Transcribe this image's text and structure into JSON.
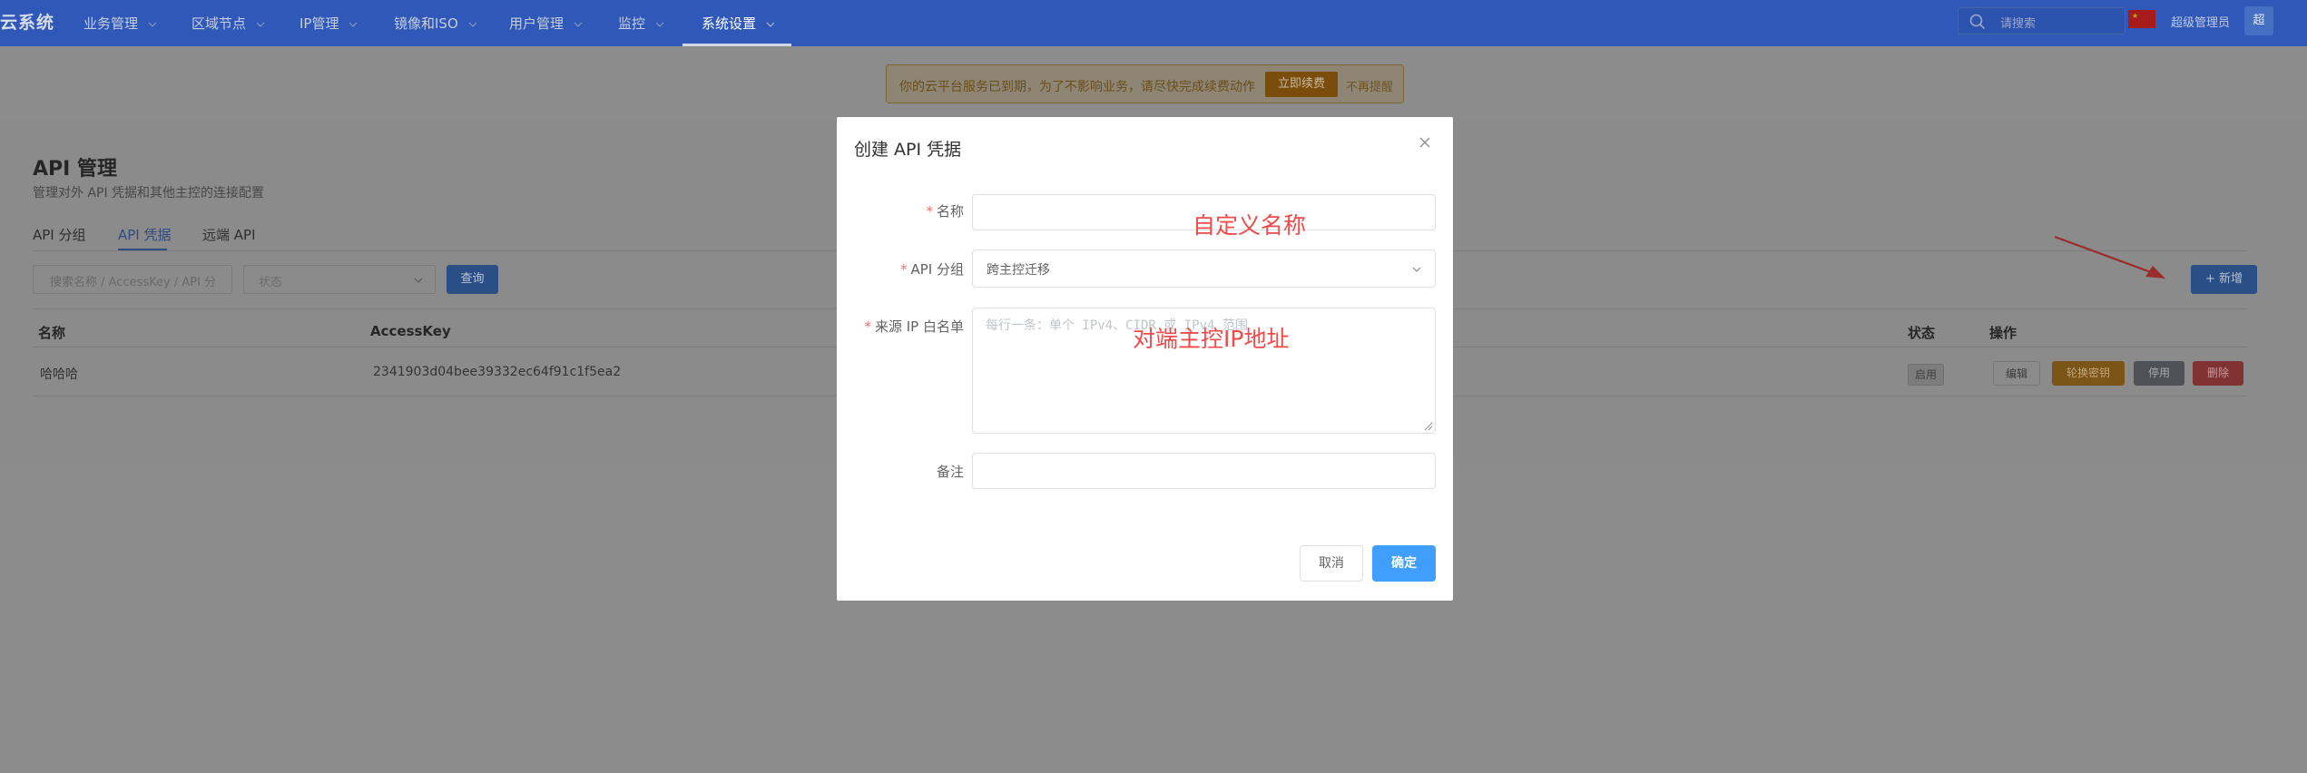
{
  "brand": "云系统",
  "nav": {
    "items": [
      {
        "label": "业务管理"
      },
      {
        "label": "区域节点"
      },
      {
        "label": "IP管理"
      },
      {
        "label": "镜像和ISO"
      },
      {
        "label": "用户管理"
      },
      {
        "label": "监控"
      },
      {
        "label": "系统设置"
      }
    ],
    "search_placeholder": "请搜索",
    "user_name": "超级管理员",
    "user_avatar": "超"
  },
  "notice": {
    "text": "你的云平台服务已到期，为了不影响业务，请尽快完成续费动作",
    "renew_label": "立即续费",
    "dismiss_label": "不再提醒"
  },
  "page": {
    "title": "API 管理",
    "subtitle": "管理对外 API 凭据和其他主控的连接配置",
    "tabs": [
      {
        "label": "API 分组"
      },
      {
        "label": "API 凭据"
      },
      {
        "label": "远端 API"
      }
    ],
    "active_tab": "API 凭据",
    "filter_placeholder": "搜索名称 / AccessKey / API 分",
    "status_placeholder": "状态",
    "query_label": "查询",
    "add_label": "+ 新增",
    "table": {
      "headers": [
        "名称",
        "AccessKey",
        "状态",
        "操作"
      ],
      "rows": [
        {
          "name": "哈哈哈",
          "access_key": "2341903d04bee39332ec64f91c1f5ea2",
          "status": "启用",
          "actions": [
            "编辑",
            "轮换密钥",
            "停用",
            "删除"
          ]
        }
      ]
    }
  },
  "modal": {
    "title": "创建 API 凭据",
    "fields": {
      "name": {
        "label": "名称",
        "value": ""
      },
      "group": {
        "label": "API 分组",
        "value": "跨主控迁移"
      },
      "whitelist": {
        "label": "来源 IP 白名单",
        "placeholder": "每行一条：单个 IPv4、CIDR 或 IPv4 范围"
      },
      "remark": {
        "label": "备注",
        "value": ""
      }
    },
    "annotations": {
      "name_hint": "自定义名称",
      "whitelist_hint": "对端主控IP地址"
    },
    "cancel_label": "取消",
    "confirm_label": "确定"
  },
  "colors": {
    "topbar": "#2f58b8",
    "primary": "#409eff",
    "annotation": "#f04a4a",
    "required": "#f56c6c",
    "overlay": "#8b8b8b"
  },
  "icons": [
    "search-icon",
    "flag-icon",
    "chevron-down-icon",
    "close-icon",
    "arrow-annotation-icon",
    "resize-handle-icon"
  ]
}
